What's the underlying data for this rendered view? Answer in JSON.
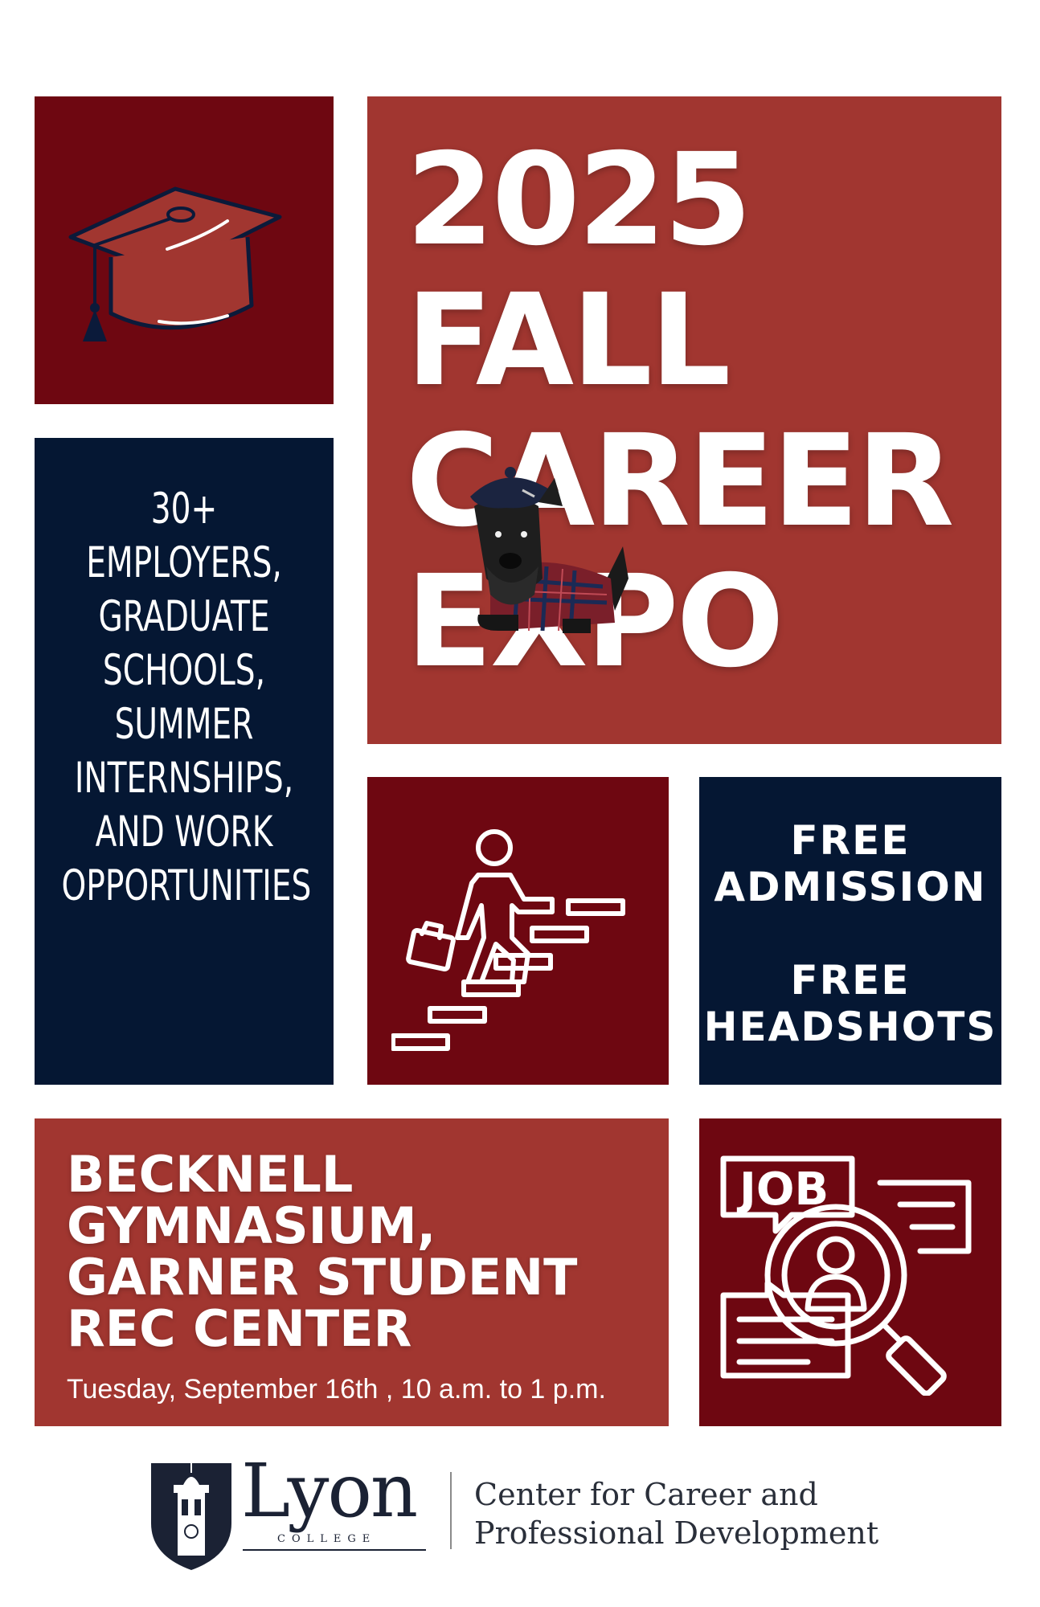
{
  "title": {
    "line1": "2025",
    "line2": "FALL",
    "line3": "CAREER",
    "line4": "EXPO"
  },
  "info": {
    "lines": [
      "30+",
      "EMPLOYERS,",
      "GRADUATE",
      "SCHOOLS,",
      "SUMMER",
      "INTERNSHIPS,",
      "AND WORK",
      "OPPORTUNITIES"
    ]
  },
  "perks": {
    "line1": "FREE",
    "line2": "ADMISSION",
    "line3": "FREE",
    "line4": "HEADSHOTS"
  },
  "venue": {
    "line1": "BECKNELL",
    "line2": "GYMNASIUM,",
    "line3": "GARNER STUDENT",
    "line4": "REC CENTER",
    "date": "Tuesday, September 16th , 10 a.m. to 1 p.m."
  },
  "job_icon_text": "JOB",
  "footer": {
    "logo_word": "Lyon",
    "logo_sub": "COLLEGE",
    "dept_line1": "Center for Career and",
    "dept_line2": "Professional Development"
  },
  "colors": {
    "maroon": "#6e0711",
    "brick": "#a13630",
    "navy": "#051733",
    "white": "#ffffff"
  },
  "icons": [
    "graduation-cap-icon",
    "scottie-dog-mascot-icon",
    "climbing-stairs-icon",
    "job-search-icon",
    "lyon-shield-icon"
  ]
}
